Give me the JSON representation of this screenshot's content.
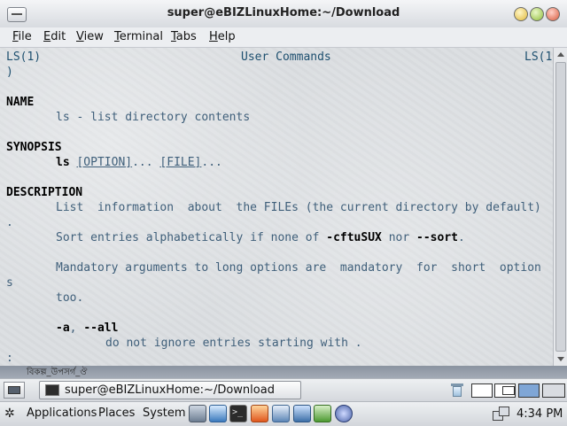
{
  "window": {
    "title": "super@eBIZLinuxHome:~/Download"
  },
  "menubar": {
    "items": [
      "File",
      "Edit",
      "View",
      "Terminal",
      "Tabs",
      "Help"
    ]
  },
  "terminal": {
    "header_left": "LS(1)",
    "header_center": "User Commands",
    "header_right": "LS(1",
    "header_wrap": ")",
    "name_heading": "NAME",
    "name_text": "ls - list directory contents",
    "synopsis_heading": "SYNOPSIS",
    "synopsis_cmd": "ls",
    "synopsis_option": "[OPTION]",
    "synopsis_sep": "...",
    "synopsis_file": "[FILE]",
    "synopsis_end": "...",
    "description_heading": "DESCRIPTION",
    "desc_line1": "List  information  about  the FILEs (the current directory by default)",
    "desc_line1_wrap": ".",
    "desc_line2_pre": "Sort entries alphabetically if none of ",
    "desc_line2_opt1": "-cftuSUX",
    "desc_line2_mid": " nor ",
    "desc_line2_opt2": "--sort",
    "desc_line2_post": ".",
    "desc_line3": "Mandatory arguments to long options are  mandatory  for  short  option",
    "desc_line3_wrap": "s",
    "desc_line4": "too.",
    "opt_a": "-a",
    "opt_sep": ", ",
    "opt_all": "--all",
    "opt_a_desc": "do not ignore entries starting with .",
    "prompt": ":"
  },
  "desktop_strip": {
    "text": "বিকল্প_উপসর্গ_ঔ"
  },
  "tasklist": {
    "task_label": "super@eBIZLinuxHome:~/Download"
  },
  "panel": {
    "applications": "Applications",
    "places": "Places",
    "system": "System",
    "clock": "4:34 PM"
  }
}
